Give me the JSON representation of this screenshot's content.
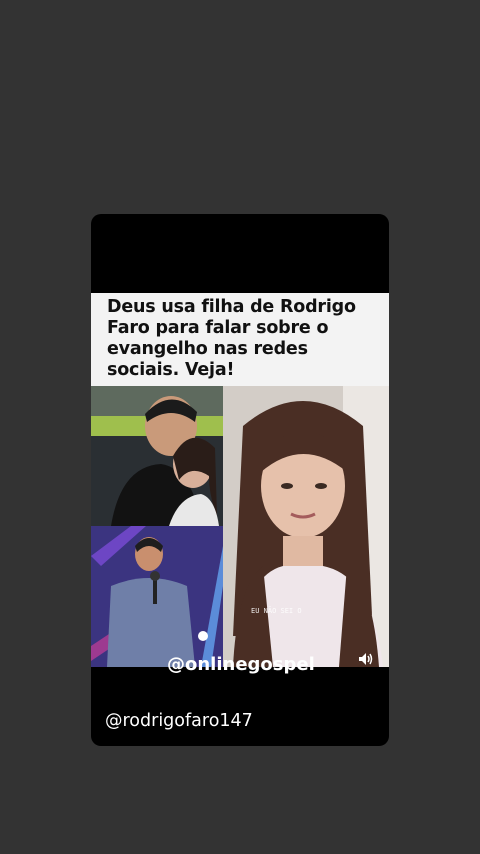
{
  "post": {
    "headline": "Deus usa filha de Rodrigo Faro para falar sobre o evangelho nas redes sociais. Veja!",
    "username": "@rodrigofaro147",
    "video_caption": "EU NÃO SEI O",
    "watermark": "@onlinegospel"
  },
  "icons": {
    "audio": "speaker-icon"
  },
  "colors": {
    "background": "#333333",
    "card": "#000000",
    "headline_bg": "#f3f3f3"
  }
}
